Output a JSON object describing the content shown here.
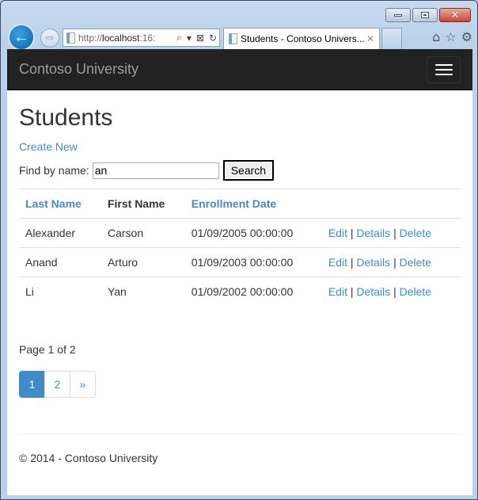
{
  "browser": {
    "back_icon": "←",
    "forward_icon": "⇨",
    "address_prefix": "http://",
    "address_host": "localhost",
    "address_suffix": ":16:",
    "search_icon": "⌕",
    "dropdown_icon": "▾",
    "compat_icon": "⊠",
    "refresh_icon": "↻",
    "tab_title": "Students - Contoso Univers...",
    "tab_close": "✕",
    "home_icon": "⌂",
    "favorites_icon": "☆",
    "tools_icon": "⚙",
    "close_glyph": "✕"
  },
  "navbar": {
    "brand": "Contoso University"
  },
  "page": {
    "title": "Students",
    "create_new": "Create New",
    "search": {
      "label": "Find by name:",
      "value": "an",
      "button": "Search"
    },
    "table": {
      "headers": [
        "Last Name",
        "First Name",
        "Enrollment Date"
      ],
      "rows": [
        {
          "last": "Alexander",
          "first": "Carson",
          "date": "01/09/2005 00:00:00"
        },
        {
          "last": "Anand",
          "first": "Arturo",
          "date": "01/09/2003 00:00:00"
        },
        {
          "last": "Li",
          "first": "Yan",
          "date": "01/09/2002 00:00:00"
        }
      ],
      "actions": {
        "edit": "Edit",
        "details": "Details",
        "delete": "Delete",
        "separator": "|"
      }
    },
    "page_info": "Page 1 of 2",
    "pagination": [
      "1",
      "2",
      "»"
    ],
    "active_page": "1"
  },
  "footer": {
    "text": "© 2014 - Contoso University"
  },
  "colors": {
    "link": "#428bca",
    "navbar_bg": "#222222",
    "brand": "#9d9d9d"
  }
}
